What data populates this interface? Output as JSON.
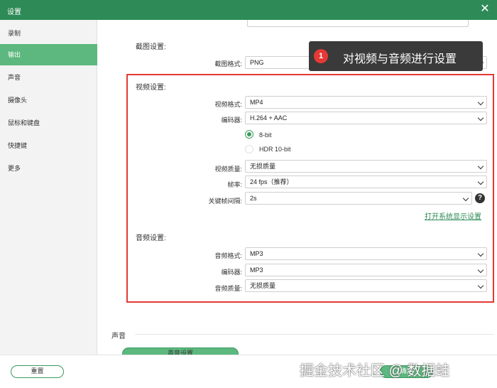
{
  "window": {
    "title": "设置",
    "close_glyph": "✕"
  },
  "sidebar": {
    "items": [
      {
        "label": "录制"
      },
      {
        "label": "输出"
      },
      {
        "label": "声音"
      },
      {
        "label": "摄像头"
      },
      {
        "label": "鼠标和键盘"
      },
      {
        "label": "快捷键"
      },
      {
        "label": "更多"
      }
    ],
    "active_index": 1
  },
  "screenshot": {
    "title": "截图设置:",
    "format_label": "截图格式:",
    "format_value": "PNG"
  },
  "tooltip": {
    "step": "1",
    "text": "对视频与音频进行设置"
  },
  "video": {
    "title": "视频设置:",
    "format_label": "视频格式:",
    "format_value": "MP4",
    "encoder_label": "编码器:",
    "encoder_value": "H.264 + AAC",
    "bitdepth_8": "8-bit",
    "bitdepth_hdr": "HDR 10-bit",
    "quality_label": "视频质量:",
    "quality_value": "无损质量",
    "fps_label": "帧率:",
    "fps_value": "24 fps（推荐）",
    "keyframe_label": "关键帧间隔:",
    "keyframe_value": "2s",
    "help_glyph": "?",
    "display_settings_link": "打开系统显示设置"
  },
  "audio": {
    "title": "音频设置:",
    "format_label": "音频格式:",
    "format_value": "MP3",
    "encoder_label": "编码器:",
    "encoder_value": "MP3",
    "quality_label": "音频质量:",
    "quality_value": "无损质量"
  },
  "sound_section": {
    "title": "声音",
    "button_label": "声音设置"
  },
  "footer": {
    "reset_label": "重置",
    "ok_label": "确定"
  },
  "watermark": "掘金技术社区 @ 数据蛙",
  "colors": {
    "brand_green": "#2e8b57",
    "sidebar_active": "#5cb87e",
    "highlight_red": "#e53935"
  }
}
